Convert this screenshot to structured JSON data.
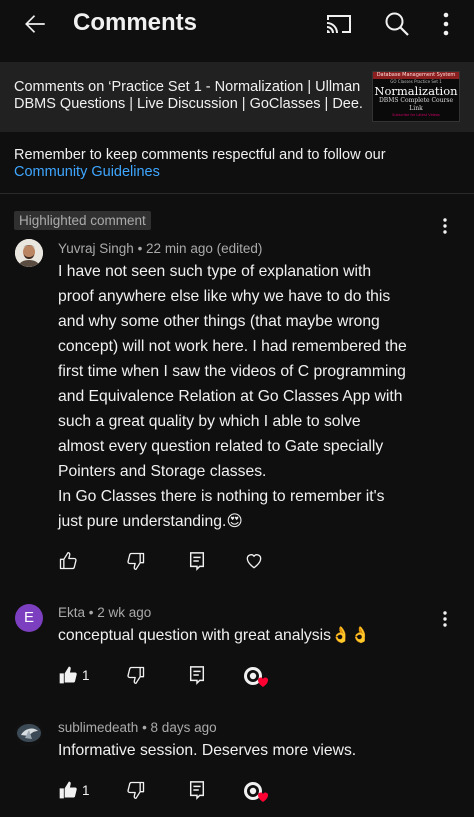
{
  "header": {
    "title": "Comments"
  },
  "video": {
    "title_line1": "Comments on ‘Practice Set 1 - Normalization | Ullman",
    "title_line2": "DBMS Questions | Live Discussion | GoClasses | Dee...",
    "thumb_header": "Database Management System",
    "thumb_sub": "GO Classes Practice Set 1",
    "thumb_big": "Normalization",
    "thumb_mid": "DBMS Complete Course Link",
    "thumb_small": "Subscribe for Latest Videos"
  },
  "guidelines": {
    "text": "Remember to keep comments respectful and to follow our",
    "link": "Community Guidelines"
  },
  "highlighted_label": "Highlighted comment",
  "comments": [
    {
      "author": "Yuvraj Singh",
      "time": "22 min ago (edited)",
      "avatar_type": "photo",
      "lines": [
        "I have not seen such type of explanation with",
        "proof anywhere else like why we have to do this",
        "and why some other things (that maybe wrong",
        "concept) will not work here. I had remembered the",
        "first time when I saw the videos of C programming",
        "and Equivalence Relation at Go Classes App with",
        "such a great quality by which I able to solve",
        "almost every question related to Gate specially",
        "Pointers and Storage classes.",
        "In Go Classes there is nothing to remember it's",
        "just pure understanding.😍"
      ],
      "likes": "",
      "liked": false,
      "hearted": false
    },
    {
      "author": "Ekta",
      "time": "2 wk ago",
      "avatar_letter": "E",
      "avatar_color": "#7b3fbf",
      "lines": [
        "conceptual question with great analysis👌👌"
      ],
      "likes": "1",
      "liked": true,
      "hearted": true
    },
    {
      "author": "sublimedeath",
      "time": "8 days ago",
      "avatar_type": "image",
      "lines": [
        "Informative session. Deserves more views."
      ],
      "likes": "1",
      "liked": true,
      "hearted": true
    }
  ],
  "colors": {
    "background": "#0f0f0f",
    "link": "#3ea6ff",
    "secondary_text": "#aaaaaa",
    "heart": "#ff0033"
  }
}
